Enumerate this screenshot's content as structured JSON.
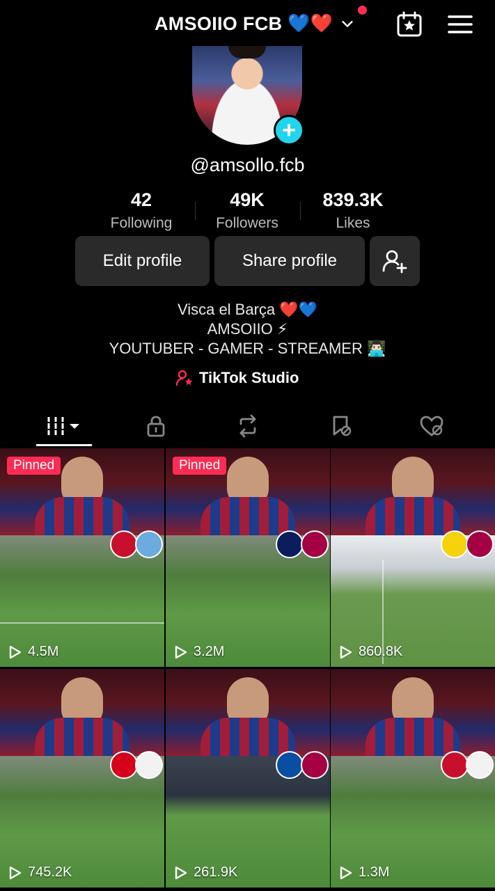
{
  "header": {
    "title": "AMSOIIO FCB",
    "title_emojis": "💙❤️",
    "icons": [
      "chevron-down-icon",
      "calendar-star-icon",
      "menu-icon"
    ],
    "notification_color": "#fe2c55"
  },
  "profile": {
    "username": "@amsollo.fcb",
    "stats": [
      {
        "value": "42",
        "label": "Following"
      },
      {
        "value": "49K",
        "label": "Followers"
      },
      {
        "value": "839.3K",
        "label": "Likes"
      }
    ],
    "buttons": {
      "edit": "Edit profile",
      "share": "Share profile"
    },
    "bio": [
      "Visca el Barça ❤️💙",
      "AMSOIIO ⚡",
      "YOUTUBER - GAMER - STREAMER 👨🏻‍💻"
    ],
    "studio_label": "TikTok Studio"
  },
  "tabs": [
    "videos-grid",
    "private",
    "reposts",
    "favorites",
    "liked"
  ],
  "videos": [
    {
      "pinned_label": "Pinned",
      "views": "4.5M"
    },
    {
      "pinned_label": "Pinned",
      "views": "3.2M"
    },
    {
      "views": "860.8K"
    },
    {
      "views": "745.2K"
    },
    {
      "views": "261.9K"
    },
    {
      "views": "1.3M"
    }
  ],
  "colors": {
    "accent": "#fe2c55",
    "teal": "#20d5ec",
    "button_bg": "#2a2a2a"
  }
}
